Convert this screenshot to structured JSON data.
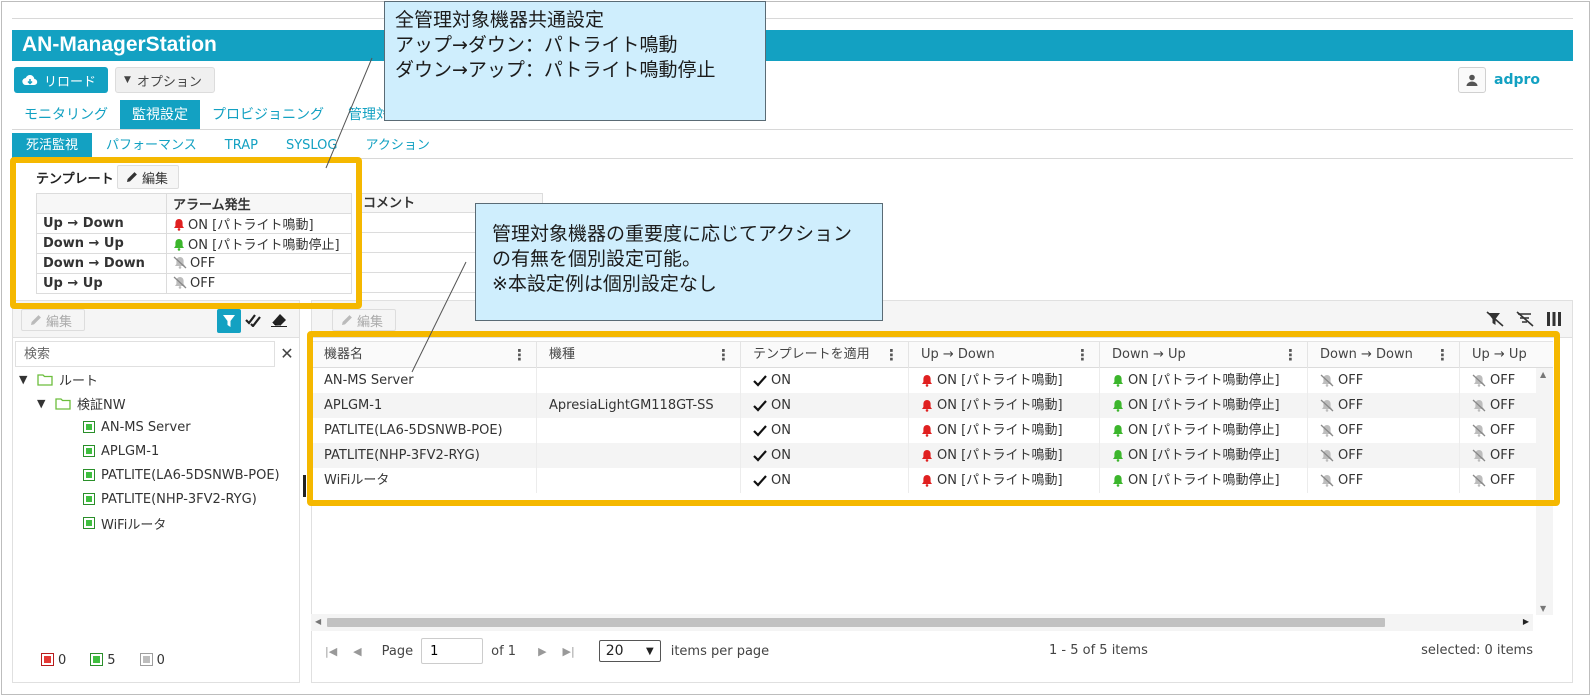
{
  "app": {
    "title": "AN-ManagerStation"
  },
  "toolbar": {
    "reload_label": "リロード",
    "option_label": "オプション"
  },
  "user": {
    "name": "adpro"
  },
  "main_tabs": [
    "モニタリング",
    "監視設定",
    "プロビジョニング",
    "管理対"
  ],
  "sub_tabs": [
    "死活監視",
    "パフォーマンス",
    "TRAP",
    "SYSLOG",
    "アクション"
  ],
  "template": {
    "label": "テンプレート",
    "edit_label": "編集",
    "header_alarm": "アラーム発生",
    "header_comment": "コメント",
    "rows": [
      {
        "name": "Up → Down",
        "alarm": "ON [パトライト鳴動]",
        "state": "on-red"
      },
      {
        "name": "Down → Up",
        "alarm": "ON [パトライト鳴動停止]",
        "state": "on-green"
      },
      {
        "name": "Down → Down",
        "alarm": "OFF",
        "state": "off"
      },
      {
        "name": "Up → Up",
        "alarm": "OFF",
        "state": "off"
      }
    ]
  },
  "left_pane": {
    "edit_label": "編集",
    "search_placeholder": "検索",
    "tree": {
      "root": "ルート",
      "group": "検証NW",
      "devices": [
        "AN-MS Server",
        "APLGM-1",
        "PATLITE(LA6-5DSNWB-POE)",
        "PATLITE(NHP-3FV2-RYG)",
        "WiFiルータ"
      ]
    },
    "status_counts": {
      "red": "0",
      "green": "5",
      "gray": "0"
    }
  },
  "grid": {
    "edit_label": "編集",
    "columns": [
      "機器名",
      "機種",
      "テンプレートを適用",
      "Up → Down",
      "Down → Up",
      "Down → Down",
      "Up → Up"
    ],
    "rows": [
      {
        "name": "AN-MS Server",
        "model": "",
        "apply": "ON",
        "up_down": "ON [パトライト鳴動]",
        "down_up": "ON [パトライト鳴動停止]",
        "down_down": "OFF",
        "up_up": "OFF"
      },
      {
        "name": "APLGM-1",
        "model": "ApresiaLightGM118GT-SS",
        "apply": "ON",
        "up_down": "ON [パトライト鳴動]",
        "down_up": "ON [パトライト鳴動停止]",
        "down_down": "OFF",
        "up_up": "OFF"
      },
      {
        "name": "PATLITE(LA6-5DSNWB-POE)",
        "model": "",
        "apply": "ON",
        "up_down": "ON [パトライト鳴動]",
        "down_up": "ON [パトライト鳴動停止]",
        "down_down": "OFF",
        "up_up": "OFF"
      },
      {
        "name": "PATLITE(NHP-3FV2-RYG)",
        "model": "",
        "apply": "ON",
        "up_down": "ON [パトライト鳴動]",
        "down_up": "ON [パトライト鳴動停止]",
        "down_down": "OFF",
        "up_up": "OFF"
      },
      {
        "name": "WiFiルータ",
        "model": "",
        "apply": "ON",
        "up_down": "ON [パトライト鳴動]",
        "down_up": "ON [パトライト鳴動停止]",
        "down_down": "OFF",
        "up_up": "OFF"
      }
    ]
  },
  "pager": {
    "page_label": "Page",
    "page_value": "1",
    "of_label": "of 1",
    "per_page_value": "20",
    "per_page_label": "items per page",
    "range_text": "1 - 5 of 5 items",
    "selected_text": "selected: 0 items"
  },
  "callouts": {
    "top": [
      "全管理対象機器共通設定",
      "アップ→ダウン：パトライト鳴動",
      "ダウン→アップ：パトライト鳴動停止"
    ],
    "middle": [
      "管理対象機器の重要度に応じてアクション",
      "の有無を個別設定可能。",
      "※本設定例は個別設定なし"
    ]
  },
  "colors": {
    "accent": "#13a1c2",
    "highlight": "#f5b800",
    "callout_bg": "#cfeefd",
    "bell_red": "#e02020",
    "bell_green": "#3cb62c"
  }
}
